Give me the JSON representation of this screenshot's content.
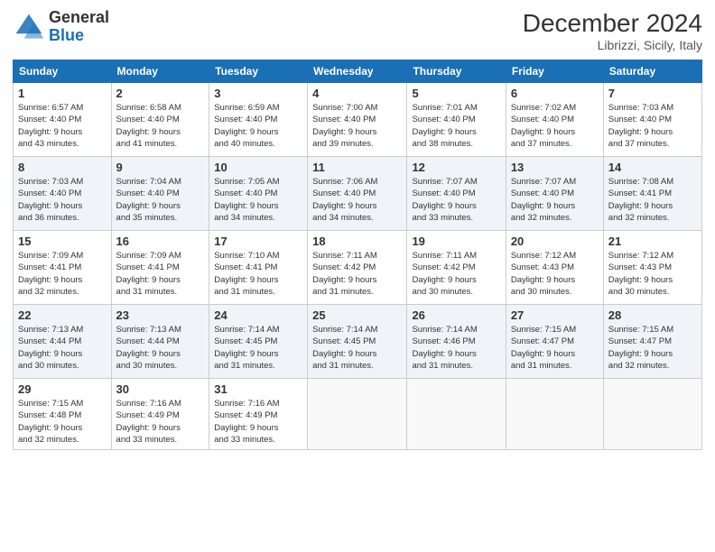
{
  "header": {
    "logo_line1": "General",
    "logo_line2": "Blue",
    "month": "December 2024",
    "location": "Librizzi, Sicily, Italy"
  },
  "days_of_week": [
    "Sunday",
    "Monday",
    "Tuesday",
    "Wednesday",
    "Thursday",
    "Friday",
    "Saturday"
  ],
  "weeks": [
    [
      {
        "day": "1",
        "info": "Sunrise: 6:57 AM\nSunset: 4:40 PM\nDaylight: 9 hours\nand 43 minutes."
      },
      {
        "day": "2",
        "info": "Sunrise: 6:58 AM\nSunset: 4:40 PM\nDaylight: 9 hours\nand 41 minutes."
      },
      {
        "day": "3",
        "info": "Sunrise: 6:59 AM\nSunset: 4:40 PM\nDaylight: 9 hours\nand 40 minutes."
      },
      {
        "day": "4",
        "info": "Sunrise: 7:00 AM\nSunset: 4:40 PM\nDaylight: 9 hours\nand 39 minutes."
      },
      {
        "day": "5",
        "info": "Sunrise: 7:01 AM\nSunset: 4:40 PM\nDaylight: 9 hours\nand 38 minutes."
      },
      {
        "day": "6",
        "info": "Sunrise: 7:02 AM\nSunset: 4:40 PM\nDaylight: 9 hours\nand 37 minutes."
      },
      {
        "day": "7",
        "info": "Sunrise: 7:03 AM\nSunset: 4:40 PM\nDaylight: 9 hours\nand 37 minutes."
      }
    ],
    [
      {
        "day": "8",
        "info": "Sunrise: 7:03 AM\nSunset: 4:40 PM\nDaylight: 9 hours\nand 36 minutes."
      },
      {
        "day": "9",
        "info": "Sunrise: 7:04 AM\nSunset: 4:40 PM\nDaylight: 9 hours\nand 35 minutes."
      },
      {
        "day": "10",
        "info": "Sunrise: 7:05 AM\nSunset: 4:40 PM\nDaylight: 9 hours\nand 34 minutes."
      },
      {
        "day": "11",
        "info": "Sunrise: 7:06 AM\nSunset: 4:40 PM\nDaylight: 9 hours\nand 34 minutes."
      },
      {
        "day": "12",
        "info": "Sunrise: 7:07 AM\nSunset: 4:40 PM\nDaylight: 9 hours\nand 33 minutes."
      },
      {
        "day": "13",
        "info": "Sunrise: 7:07 AM\nSunset: 4:40 PM\nDaylight: 9 hours\nand 32 minutes."
      },
      {
        "day": "14",
        "info": "Sunrise: 7:08 AM\nSunset: 4:41 PM\nDaylight: 9 hours\nand 32 minutes."
      }
    ],
    [
      {
        "day": "15",
        "info": "Sunrise: 7:09 AM\nSunset: 4:41 PM\nDaylight: 9 hours\nand 32 minutes."
      },
      {
        "day": "16",
        "info": "Sunrise: 7:09 AM\nSunset: 4:41 PM\nDaylight: 9 hours\nand 31 minutes."
      },
      {
        "day": "17",
        "info": "Sunrise: 7:10 AM\nSunset: 4:41 PM\nDaylight: 9 hours\nand 31 minutes."
      },
      {
        "day": "18",
        "info": "Sunrise: 7:11 AM\nSunset: 4:42 PM\nDaylight: 9 hours\nand 31 minutes."
      },
      {
        "day": "19",
        "info": "Sunrise: 7:11 AM\nSunset: 4:42 PM\nDaylight: 9 hours\nand 30 minutes."
      },
      {
        "day": "20",
        "info": "Sunrise: 7:12 AM\nSunset: 4:43 PM\nDaylight: 9 hours\nand 30 minutes."
      },
      {
        "day": "21",
        "info": "Sunrise: 7:12 AM\nSunset: 4:43 PM\nDaylight: 9 hours\nand 30 minutes."
      }
    ],
    [
      {
        "day": "22",
        "info": "Sunrise: 7:13 AM\nSunset: 4:44 PM\nDaylight: 9 hours\nand 30 minutes."
      },
      {
        "day": "23",
        "info": "Sunrise: 7:13 AM\nSunset: 4:44 PM\nDaylight: 9 hours\nand 30 minutes."
      },
      {
        "day": "24",
        "info": "Sunrise: 7:14 AM\nSunset: 4:45 PM\nDaylight: 9 hours\nand 31 minutes."
      },
      {
        "day": "25",
        "info": "Sunrise: 7:14 AM\nSunset: 4:45 PM\nDaylight: 9 hours\nand 31 minutes."
      },
      {
        "day": "26",
        "info": "Sunrise: 7:14 AM\nSunset: 4:46 PM\nDaylight: 9 hours\nand 31 minutes."
      },
      {
        "day": "27",
        "info": "Sunrise: 7:15 AM\nSunset: 4:47 PM\nDaylight: 9 hours\nand 31 minutes."
      },
      {
        "day": "28",
        "info": "Sunrise: 7:15 AM\nSunset: 4:47 PM\nDaylight: 9 hours\nand 32 minutes."
      }
    ],
    [
      {
        "day": "29",
        "info": "Sunrise: 7:15 AM\nSunset: 4:48 PM\nDaylight: 9 hours\nand 32 minutes."
      },
      {
        "day": "30",
        "info": "Sunrise: 7:16 AM\nSunset: 4:49 PM\nDaylight: 9 hours\nand 33 minutes."
      },
      {
        "day": "31",
        "info": "Sunrise: 7:16 AM\nSunset: 4:49 PM\nDaylight: 9 hours\nand 33 minutes."
      },
      null,
      null,
      null,
      null
    ]
  ]
}
